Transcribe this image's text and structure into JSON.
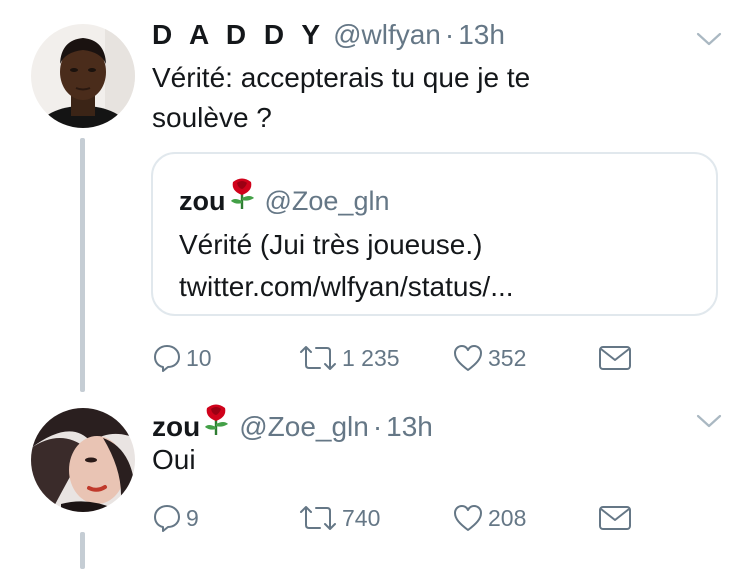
{
  "tweet1": {
    "display_name": "D A D D Y",
    "handle": "@wlfyan",
    "separator": "·",
    "time": "13h",
    "text_line1": "Vérité: accepterais tu que je te",
    "text_line2": "soulève ?",
    "quote": {
      "display_name": "zou",
      "handle": "@Zoe_gln",
      "line1": "Vérité (Jui très joueuse.)",
      "line2": "twitter.com/wlfyan/status/..."
    },
    "actions": {
      "replies": "10",
      "retweets": "1 235",
      "likes": "352"
    }
  },
  "tweet2": {
    "display_name": "zou",
    "handle": "@Zoe_gln",
    "separator": "·",
    "time": "13h",
    "text": "Oui",
    "actions": {
      "replies": "9",
      "retweets": "740",
      "likes": "208"
    }
  },
  "colors": {
    "text": "#14171a",
    "secondary": "#657786",
    "thread_line": "#c5cdd4",
    "border": "#e1e8ed",
    "rose": "#d0021b"
  },
  "icons": [
    "reply-icon",
    "retweet-icon",
    "like-icon",
    "direct-message-icon",
    "chevron-down-icon",
    "rose-emoji"
  ]
}
